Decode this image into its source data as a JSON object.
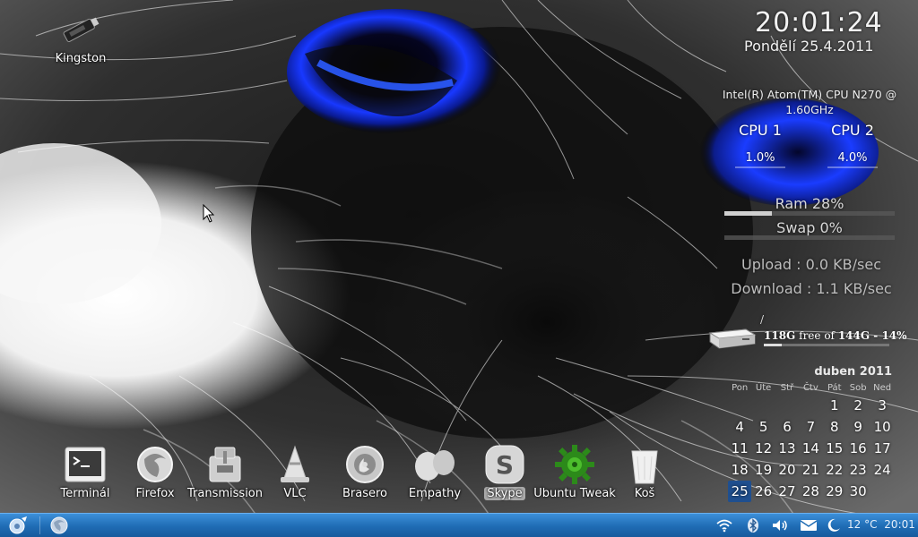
{
  "desktop": {
    "icons": [
      {
        "label": "Kingston",
        "icon": "usb-drive-icon"
      }
    ]
  },
  "conky": {
    "time": "20:01:24",
    "date": "Pondělí 25.4.2011",
    "cpu_model": "Intel(R) Atom(TM) CPU N270  @ 1.60GHz",
    "cpu1": {
      "label": "CPU 1",
      "value": "1.0%"
    },
    "cpu2": {
      "label": "CPU 2",
      "value": "4.0%"
    },
    "ram": {
      "label": "Ram 28%",
      "percent": 28
    },
    "swap": {
      "label": "Swap 0%",
      "percent": 0
    },
    "upload": "Upload : 0.0 KB/sec",
    "download": "Download : 1.1 KB/sec",
    "disk": {
      "mount": "/",
      "free": "118G",
      "free_of": "free of",
      "total": "144G - 14%",
      "used_percent": 14,
      "icon": "hard-drive-icon"
    }
  },
  "calendar": {
    "month": "duben 2011",
    "weekdays": [
      "Pon",
      "Úte",
      "Stř",
      "Čtv",
      "Pát",
      "Sob",
      "Ned"
    ],
    "weeks": [
      [
        "",
        "",
        "",
        "",
        "1",
        "2",
        "3"
      ],
      [
        "4",
        "5",
        "6",
        "7",
        "8",
        "9",
        "10"
      ],
      [
        "11",
        "12",
        "13",
        "14",
        "15",
        "16",
        "17"
      ],
      [
        "18",
        "19",
        "20",
        "21",
        "22",
        "23",
        "24"
      ],
      [
        "25",
        "26",
        "27",
        "28",
        "29",
        "30",
        ""
      ]
    ],
    "today": "25"
  },
  "dock": {
    "items": [
      {
        "label": "Terminál",
        "icon": "terminal-icon"
      },
      {
        "label": "Firefox",
        "icon": "firefox-icon"
      },
      {
        "label": "Transmission",
        "icon": "transmission-icon"
      },
      {
        "label": "VLC",
        "icon": "vlc-cone-icon"
      },
      {
        "label": "Brasero",
        "icon": "brasero-disc-icon"
      },
      {
        "label": "Empathy",
        "icon": "empathy-icon"
      },
      {
        "label": "Skype",
        "icon": "skype-icon"
      },
      {
        "label": "Ubuntu Tweak",
        "icon": "ubuntu-tweak-gear-icon"
      },
      {
        "label": "Koš",
        "icon": "trash-icon"
      }
    ],
    "active": "Skype"
  },
  "panel": {
    "menu_icon": "main-menu-icon",
    "launcher_icon": "firefox-icon",
    "tray": [
      "wifi-icon",
      "bluetooth-icon",
      "volume-icon",
      "mail-icon",
      "moon-weather-icon"
    ],
    "weather": "12 °C",
    "clock": "20:01"
  },
  "colors": {
    "panel": "#1f6cb4",
    "eye_blue": "#1030e0",
    "today_highlight": "#1f4f8f"
  }
}
